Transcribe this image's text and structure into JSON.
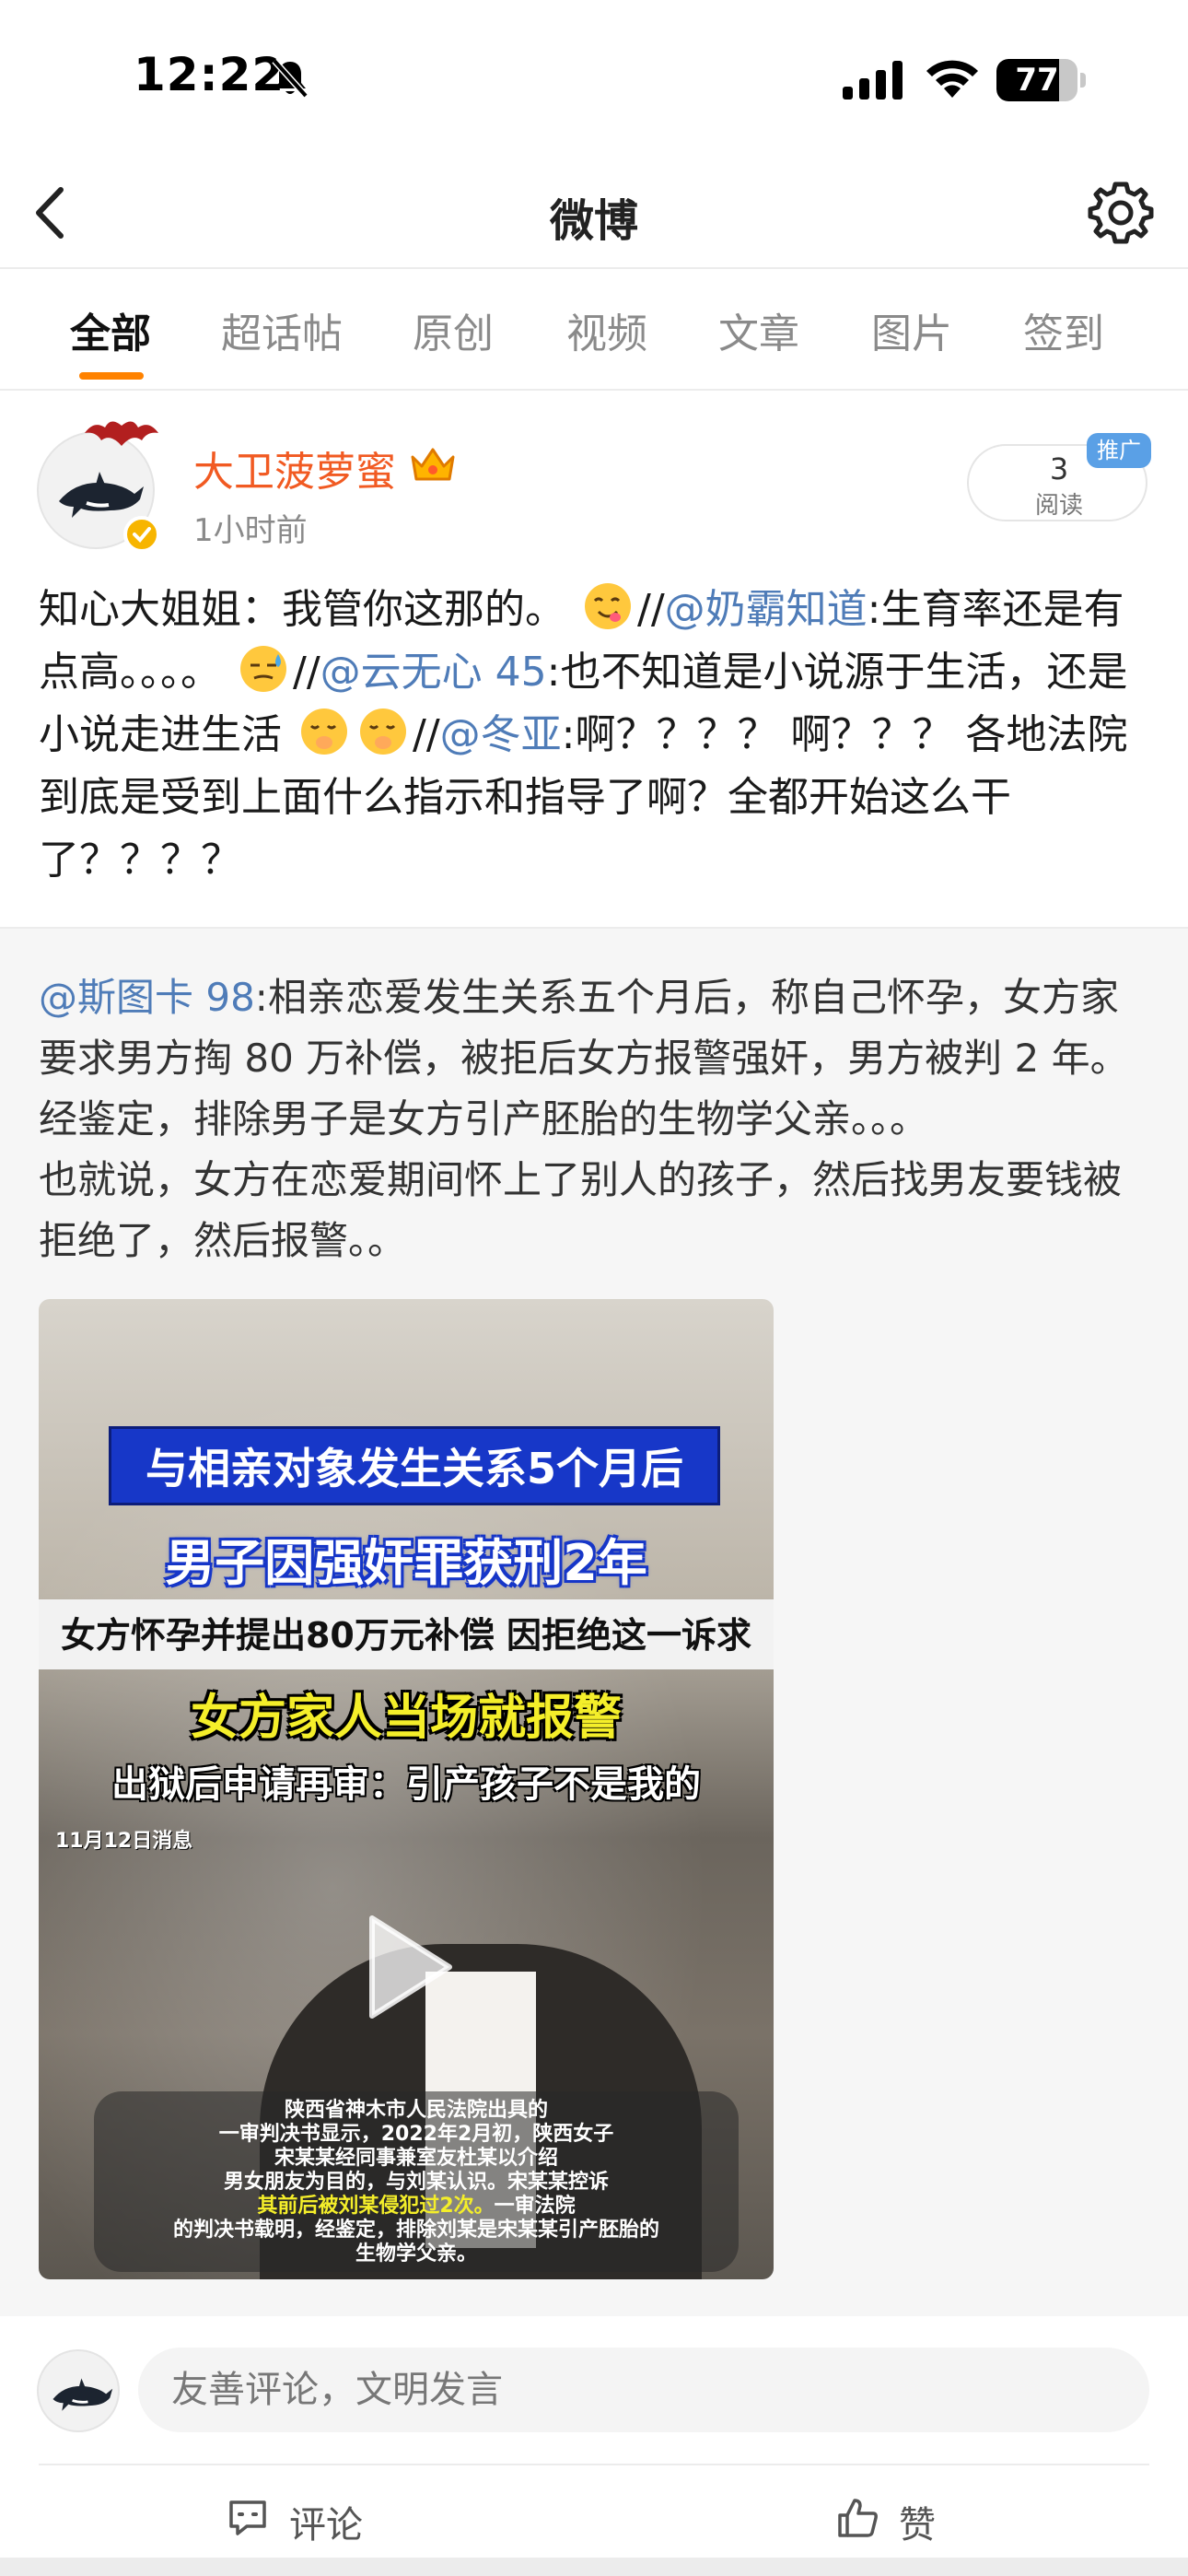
{
  "status_bar": {
    "time": "12:22",
    "battery_percent": "77",
    "battery_level": 0.77
  },
  "nav": {
    "title": "微博",
    "back_icon": "back-chevron-icon",
    "settings_icon": "gear-icon"
  },
  "tabs": [
    {
      "label": "全部",
      "active": true
    },
    {
      "label": "超话帖",
      "active": false
    },
    {
      "label": "原创",
      "active": false
    },
    {
      "label": "视频",
      "active": false
    },
    {
      "label": "文章",
      "active": false
    },
    {
      "label": "图片",
      "active": false
    },
    {
      "label": "签到",
      "active": false
    }
  ],
  "colors": {
    "accent": "#ff8200",
    "author_name": "#f15a22",
    "mention": "#4f7cb8",
    "promo_tag": "#5aa0e6"
  },
  "post": {
    "author": "大卫菠萝蜜",
    "time": "1小时前",
    "reads_count": "3",
    "reads_label": "阅读",
    "promo_tag": "推广",
    "text": {
      "p1": "知心大姐姐：我管你这那的。",
      "sep1": "//",
      "m1": "@奶霸知道",
      "p2": ":生育率还是有点高。。。。",
      "sep2": "//",
      "m2": "@云无心 45",
      "p3": ":也不知道是小说源于生活，还是小说走进生活",
      "sep3": "//",
      "m3": "@冬亚",
      "p4": ":啊？？？？ 啊？？？ 各地法院到底是受到上面什么指示和指导了啊？全都开始这么干了？？？？"
    }
  },
  "repost": {
    "mention": "@斯图卡 98",
    "text": ":相亲恋爱发生关系五个月后，称自己怀孕，女方家要求男方掏 80 万补偿，被拒后女方报警强奸，男方被判 2 年。经鉴定，排除男子是女方引产胚胎的生物学父亲。。。",
    "text2": "也就说，女方在恋爱期间怀上了别人的孩子，然后找男友要钱被拒绝了，然后报警。。",
    "video": {
      "line1": "与相亲对象发生关系5个月后",
      "line2": "男子因强奸罪获刑2年",
      "line3": "女方怀孕并提出80万元补偿 因拒绝这一诉求",
      "line4": "女方家人当场就报警",
      "line5": "出狱后申请再审：引产孩子不是我的",
      "date": "11月12日消息",
      "caption1": "陕西省神木市人民法院出具的",
      "caption2": "一审判决书显示，2022年2月初，陕西女子",
      "caption3": "宋某某经同事兼室友杜某以介绍",
      "caption4": "男女朋友为目的，与刘某认识。宋某某控诉",
      "caption5_hl": "其前后被刘某侵犯过2次。",
      "caption5": "一审法院",
      "caption6": "的判决书载明，经鉴定，排除刘某是宋某某引产胚胎的",
      "caption7": "生物学父亲。"
    }
  },
  "comment_bar": {
    "placeholder": "友善评论，文明发言",
    "comment_label": "评论",
    "like_label": "赞"
  }
}
